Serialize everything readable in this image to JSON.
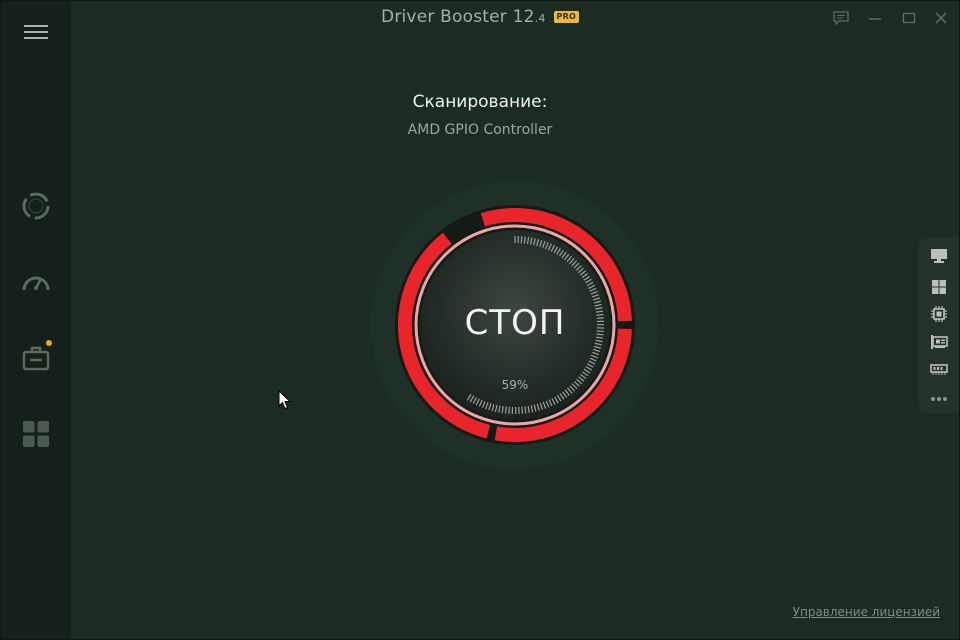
{
  "app": {
    "title": "Driver Booster 12",
    "version": ".4",
    "edition_badge": "PRO"
  },
  "sidebar": {
    "items": [
      {
        "name": "menu",
        "icon": "hamburger-icon"
      },
      {
        "name": "scan",
        "icon": "scan-ring-icon"
      },
      {
        "name": "boost",
        "icon": "speedometer-icon"
      },
      {
        "name": "toolbox",
        "icon": "toolbox-icon",
        "badge": true
      },
      {
        "name": "action-center",
        "icon": "grid-icon"
      }
    ]
  },
  "scan": {
    "heading": "Сканирование:",
    "current_device": "AMD GPIO Controller",
    "stop_label": "СТОП",
    "progress_label": "59%",
    "progress_value": 0.59
  },
  "right_panel": {
    "items": [
      "monitor-icon",
      "windows-icon",
      "chip-icon",
      "network-card-icon",
      "memory-icon",
      "more-icon"
    ]
  },
  "footer": {
    "license_link": "Управление лицензией"
  },
  "colors": {
    "background": "#1c2c23",
    "sidebar": "#142019",
    "accent_red": "#e8252a",
    "badge": "#f2a71b",
    "pro_badge": "#e9b937"
  }
}
